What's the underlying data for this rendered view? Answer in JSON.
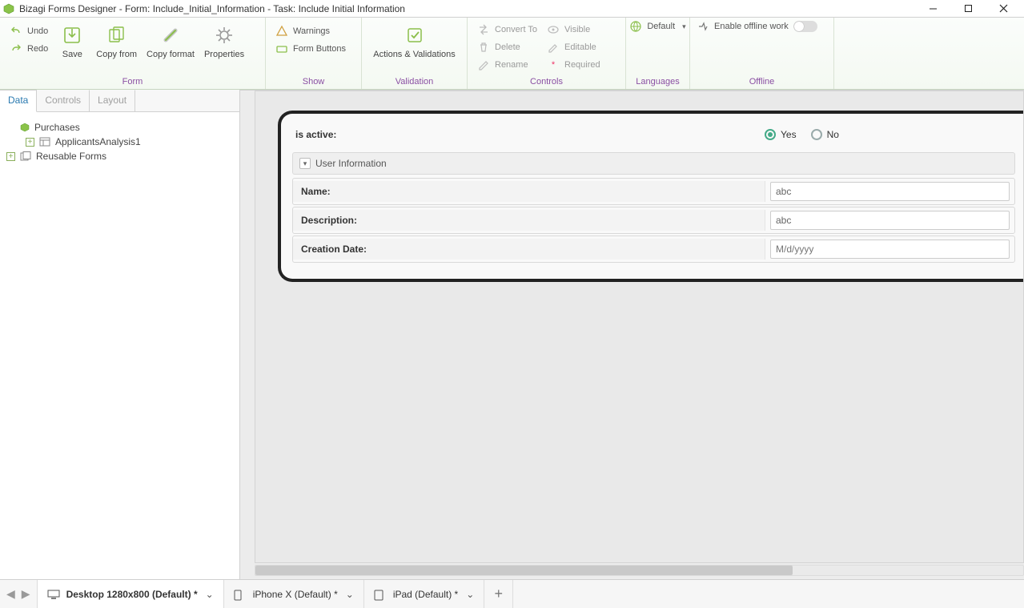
{
  "title": "Bizagi Forms Designer  - Form: Include_Initial_Information - Task:  Include Initial Information",
  "ribbon": {
    "groups": {
      "form": {
        "label": "Form",
        "undo": "Undo",
        "redo": "Redo",
        "save": "Save",
        "copy_from": "Copy from",
        "copy_format": "Copy format",
        "properties": "Properties"
      },
      "show": {
        "label": "Show",
        "warnings": "Warnings",
        "form_buttons": "Form Buttons"
      },
      "validation": {
        "label": "Validation",
        "actions_validations": "Actions & Validations"
      },
      "controls": {
        "label": "Controls",
        "convert_to": "Convert To",
        "delete": "Delete",
        "rename": "Rename",
        "visible": "Visible",
        "editable": "Editable",
        "required": "Required"
      },
      "languages": {
        "label": "Languages",
        "default": "Default"
      },
      "offline": {
        "label": "Offline",
        "enable": "Enable offline work"
      }
    }
  },
  "left_panel": {
    "tabs": {
      "data": "Data",
      "controls": "Controls",
      "layout": "Layout"
    },
    "tree": {
      "root": "Purchases",
      "child1": "ApplicantsAnalysis1",
      "reusable": "Reusable Forms"
    }
  },
  "form": {
    "is_active_label": "is active:",
    "yes": "Yes",
    "no": "No",
    "group_header": "User Information",
    "rows": {
      "name": {
        "label": "Name:",
        "value": "abc"
      },
      "description": {
        "label": "Description:",
        "value": "abc"
      },
      "creation_date": {
        "label": "Creation Date:",
        "placeholder": "M/d/yyyy"
      }
    }
  },
  "device_tabs": {
    "desktop": "Desktop 1280x800 (Default) *",
    "iphone": "iPhone X (Default) *",
    "ipad": "iPad (Default) *"
  }
}
